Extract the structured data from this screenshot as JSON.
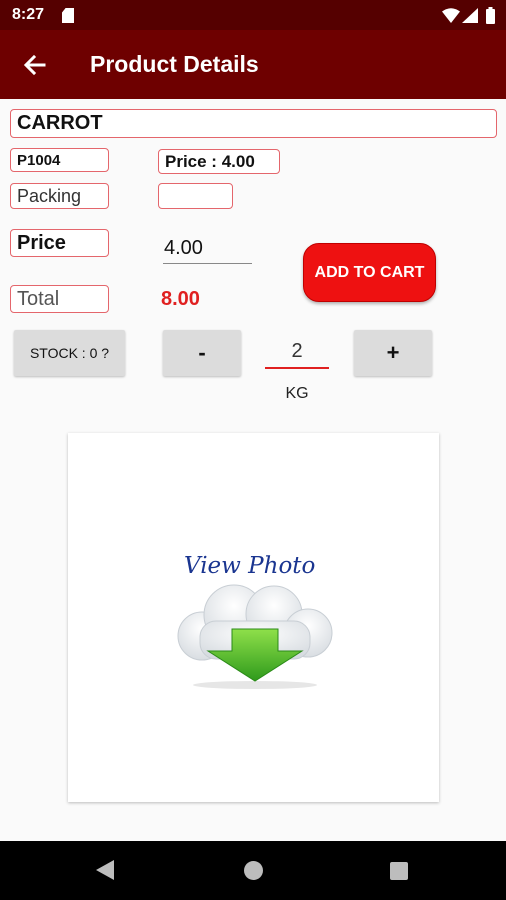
{
  "status_bar": {
    "time": "8:27"
  },
  "app_bar": {
    "title": "Product Details"
  },
  "product": {
    "name": "CARROT",
    "code": "P1004",
    "price_box": "Price : 4.00",
    "packing_label": "Packing",
    "packing_value": "",
    "price_label": "Price",
    "price_value": "4.00",
    "total_label": "Total",
    "total_value": "8.00"
  },
  "actions": {
    "add_to_cart": "ADD TO CART"
  },
  "quantity": {
    "stock_label": "STOCK : 0 ?",
    "minus": "-",
    "plus": "+",
    "value": "2",
    "unit": "KG"
  },
  "photo": {
    "label": "View Photo"
  },
  "colors": {
    "status_bar": "#550000",
    "app_bar": "#6e0000",
    "accent_red": "#ee1111",
    "box_border": "#e4666c",
    "photo_text": "#1a3590"
  },
  "icons": [
    "sim-icon",
    "wifi-icon",
    "signal-icon",
    "battery-icon",
    "back-arrow-icon",
    "cloud-download-icon",
    "nav-back-icon",
    "nav-home-icon",
    "nav-recent-icon"
  ]
}
